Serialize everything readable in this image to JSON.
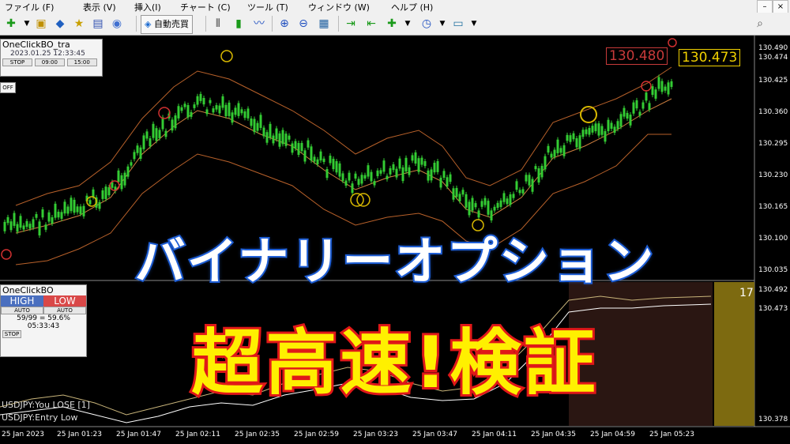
{
  "menu": {
    "items": [
      "ファイル (F)",
      "表示 (V)",
      "挿入(I)",
      "チャート (C)",
      "ツール (T)",
      "ウィンドウ (W)",
      "ヘルプ (H)"
    ]
  },
  "toolbar": {
    "autotrade_label": "自動売買"
  },
  "panel_top": {
    "title": "OneClickBO_tra",
    "datetime": "2023.01.25 12:33:45",
    "buttons": [
      "STOP",
      "09:00",
      "15:00"
    ],
    "off_label": "OFF"
  },
  "panel_bottom": {
    "title": "OneClickBO",
    "high_label": "HIGH",
    "low_label": "LOW",
    "auto_left": "AUTO",
    "auto_right": "AUTO",
    "stats": "59/99 = 59.6%",
    "time": "05:33:43",
    "stop_label": "STOP"
  },
  "price_axis": {
    "labels": [
      "130.490",
      "130.474",
      "130.425",
      "130.360",
      "130.295",
      "130.230",
      "130.165",
      "130.100",
      "130.035",
      "130.492",
      "130.473",
      "130.378"
    ]
  },
  "time_axis": {
    "labels": [
      "25 Jan 2023",
      "25 Jan 01:23",
      "25 Jan 01:47",
      "25 Jan 02:11",
      "25 Jan 02:35",
      "25 Jan 02:59",
      "25 Jan 03:23",
      "25 Jan 03:47",
      "25 Jan 04:11",
      "25 Jan 04:35",
      "25 Jan 04:59",
      "25 Jan 05:23"
    ]
  },
  "price_tags": {
    "bid": "130.480",
    "ask": "130.473"
  },
  "countdown": "17",
  "status_lines": [
    "USDJPY:You LOSE [1]",
    "USDJPY:Entry Low"
  ],
  "overlay": {
    "line1": "バイナリーオプション",
    "line2": "超高速!検証"
  },
  "colors": {
    "candle_bull": "#33cc33",
    "band": "#b8612a",
    "title_outline": "#1f5fd6",
    "headline_fill": "#fff000",
    "headline_outline": "#e01818",
    "price_tag_bid": "#c83a3a",
    "price_tag_ask": "#f0d000"
  }
}
